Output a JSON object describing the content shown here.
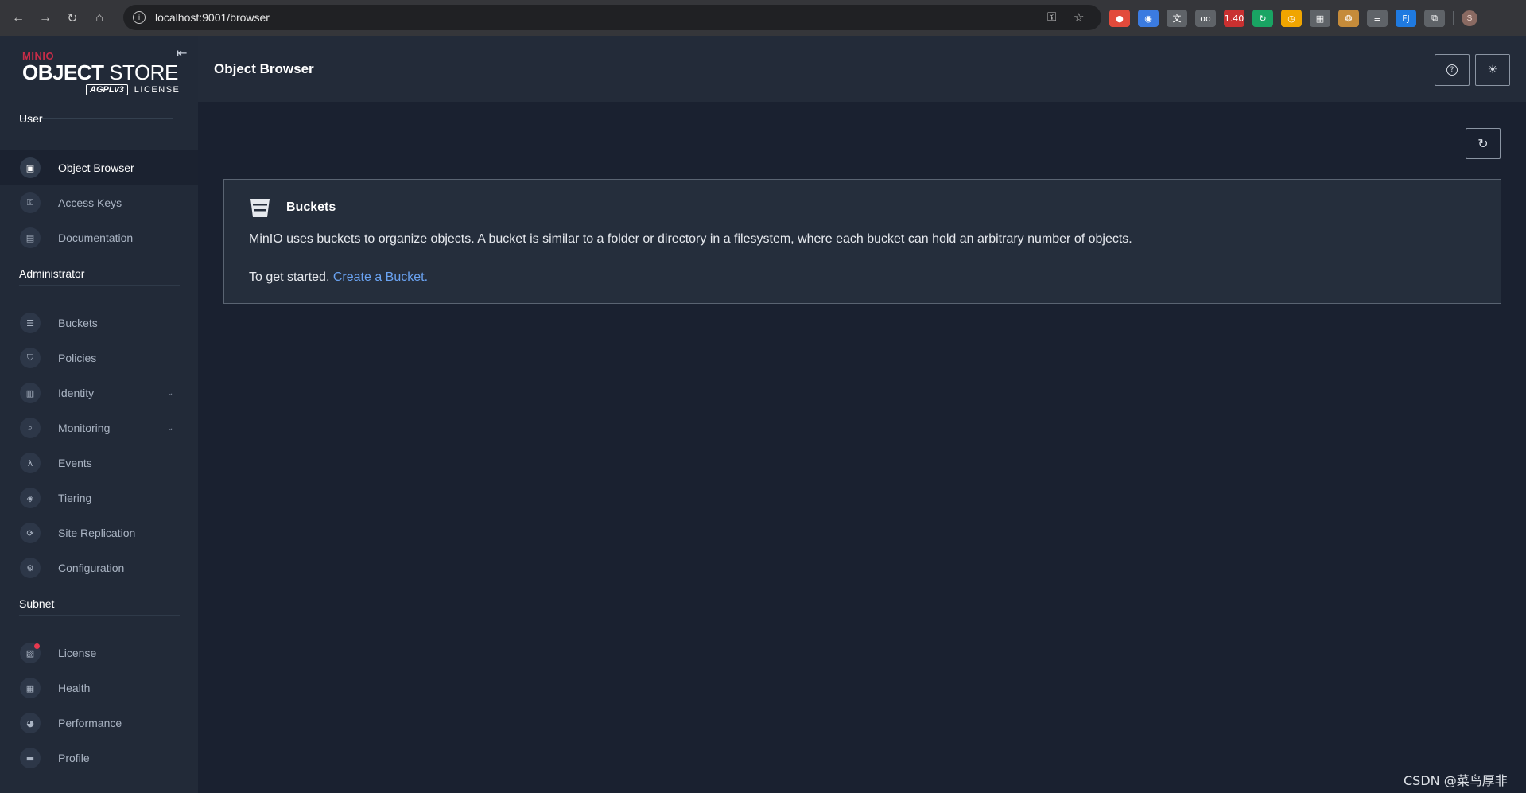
{
  "browser": {
    "url": "localhost:9001/browser",
    "nav": {
      "back_icon": "←",
      "forward_icon": "→",
      "reload_icon": "↻",
      "home_icon": "⌂"
    },
    "info_icon": "i",
    "key_icon": "⚿",
    "star_icon": "☆",
    "extensions": [
      {
        "name": "ext-chrome-color",
        "glyph": "●",
        "color": "#e24a3b"
      },
      {
        "name": "ext-firefox-like",
        "glyph": "◉",
        "color": "#3b7be0"
      },
      {
        "name": "ext-translate",
        "glyph": "文",
        "color": "#5f6368"
      },
      {
        "name": "ext-glasses",
        "glyph": "oo",
        "color": "#5f6368"
      },
      {
        "name": "ext-badge-140",
        "glyph": "1.40",
        "color": "#c93030"
      },
      {
        "name": "ext-green-refresh",
        "glyph": "↻",
        "color": "#19a463"
      },
      {
        "name": "ext-clock",
        "glyph": "◷",
        "color": "#f0a500"
      },
      {
        "name": "ext-qr",
        "glyph": "▦",
        "color": "#5f6368"
      },
      {
        "name": "ext-cookie",
        "glyph": "❂",
        "color": "#c58b3a"
      },
      {
        "name": "ext-reader",
        "glyph": "≡",
        "color": "#5f6368"
      },
      {
        "name": "ext-fj",
        "glyph": "FJ",
        "color": "#1f7ae0"
      },
      {
        "name": "ext-puzzle",
        "glyph": "⧉",
        "color": "#5f6368"
      }
    ],
    "profile_initial": "S"
  },
  "sidebar": {
    "logo": {
      "brand": "MINIO",
      "product_bold": "OBJECT",
      "product_light": " STORE",
      "agpl": "AGPLv3",
      "license": "LICENSE"
    },
    "collapse_icon": "⇤",
    "sections": [
      {
        "title": "User",
        "items": [
          {
            "label": "Object Browser",
            "icon": "▣",
            "active": true
          },
          {
            "label": "Access Keys",
            "icon": "⚿"
          },
          {
            "label": "Documentation",
            "icon": "▤"
          }
        ]
      },
      {
        "title": "Administrator",
        "items": [
          {
            "label": "Buckets",
            "icon": "☰"
          },
          {
            "label": "Policies",
            "icon": "⛉"
          },
          {
            "label": "Identity",
            "icon": "▥",
            "chevron": "⌄"
          },
          {
            "label": "Monitoring",
            "icon": "⌕",
            "chevron": "⌄"
          },
          {
            "label": "Events",
            "icon": "λ"
          },
          {
            "label": "Tiering",
            "icon": "◈"
          },
          {
            "label": "Site Replication",
            "icon": "⟳"
          },
          {
            "label": "Configuration",
            "icon": "⚙"
          }
        ]
      },
      {
        "title": "Subnet",
        "items": [
          {
            "label": "License",
            "icon": "▧",
            "badge_dot": true
          },
          {
            "label": "Health",
            "icon": "▦"
          },
          {
            "label": "Performance",
            "icon": "◕"
          },
          {
            "label": "Profile",
            "icon": "▬"
          }
        ]
      }
    ]
  },
  "header": {
    "title": "Object Browser",
    "help_icon": "?",
    "theme_icon": "☀"
  },
  "main": {
    "refresh_icon": "↻",
    "panel": {
      "title": "Buckets",
      "description": "MinIO uses buckets to organize objects. A bucket is similar to a folder or directory in a filesystem, where each bucket can hold an arbitrary number of objects.",
      "cta_prefix": "To get started, ",
      "cta_link": "Create a Bucket."
    }
  },
  "watermark": "CSDN @菜鸟厚非"
}
